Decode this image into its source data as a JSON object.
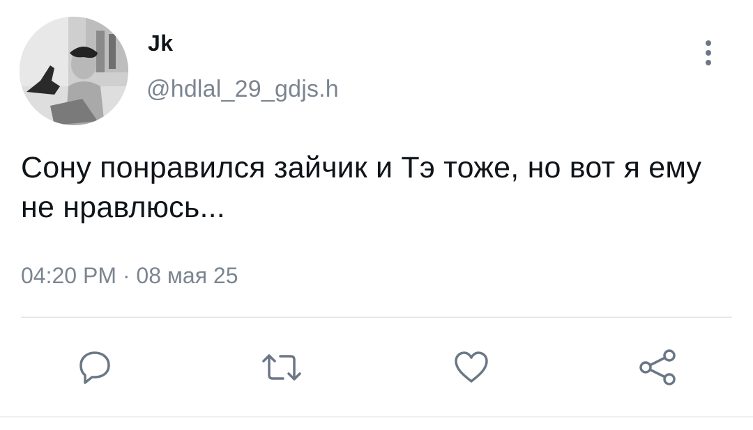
{
  "tweet": {
    "author": {
      "display_name": "Jk",
      "handle": "@hdlal_29_gdjs.h"
    },
    "text": "Сону понравился зайчик и Тэ тоже, но вот я ему не нравлюсь...",
    "time": "04:20 PM · 08 мая 25"
  },
  "icons": {
    "more": "more-vertical-icon",
    "reply": "reply-icon",
    "retweet": "retweet-icon",
    "like": "heart-icon",
    "share": "share-icon"
  },
  "colors": {
    "text": "#0f1419",
    "secondary": "#7b8591",
    "icon": "#6b7785",
    "divider": "#e6e9ec"
  }
}
